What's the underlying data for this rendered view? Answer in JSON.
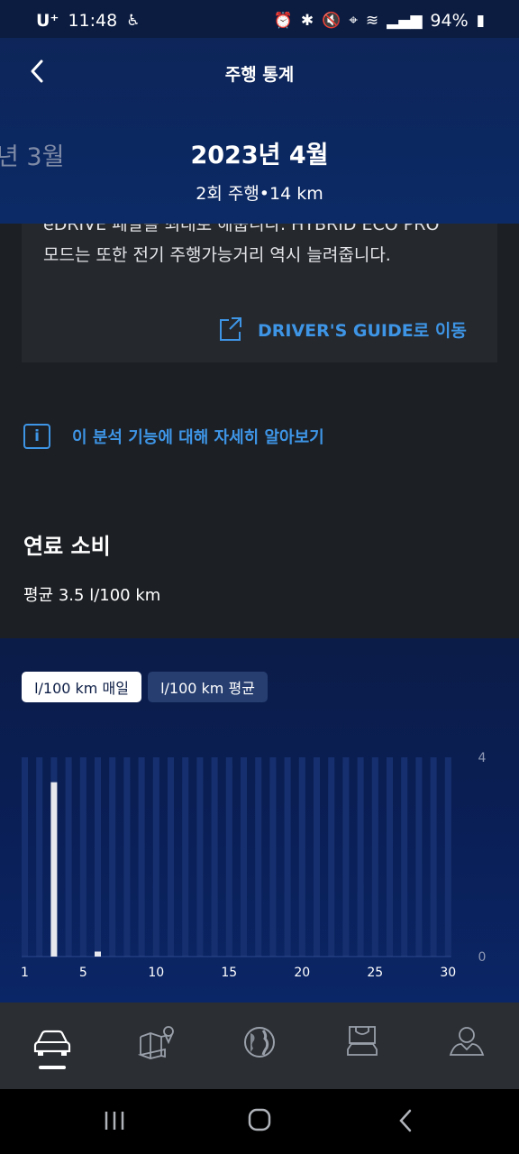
{
  "status_bar": {
    "carrier": "U⁺",
    "time": "11:48",
    "battery": "94%",
    "icons": [
      "accessibility-icon",
      "alarm-icon",
      "bluetooth-icon",
      "mute-icon",
      "location-icon",
      "wifi-icon",
      "signal-icon",
      "battery-icon"
    ]
  },
  "header": {
    "title": "주행 통계",
    "prev_month": "년 3월",
    "current_month": "2023년 4월",
    "summary": "2회 주행•14 km"
  },
  "card": {
    "cut_line": "eDRIVE 페달을 최대로 해줍니다. HYBRID ECO PRO",
    "text": "모드는 또한 전기 주행가능거리 역시 늘려줍니다.",
    "link_label": "DRIVER'S GUIDE로 이동"
  },
  "learn_more": "이 분석 기능에 대해 자세히 알아보기",
  "fuel": {
    "title": "연료 소비",
    "average": "평균 3.5 l/100 km"
  },
  "tabs": [
    {
      "label": "l/100 km 매일",
      "active": true
    },
    {
      "label": "l/100 km 평균",
      "active": false
    }
  ],
  "chart_data": {
    "type": "bar",
    "x": [
      1,
      2,
      3,
      4,
      5,
      6,
      7,
      8,
      9,
      10,
      11,
      12,
      13,
      14,
      15,
      16,
      17,
      18,
      19,
      20,
      21,
      22,
      23,
      24,
      25,
      26,
      27,
      28,
      29,
      30
    ],
    "values": [
      0,
      0,
      3.5,
      0,
      0,
      0.1,
      0,
      0,
      0,
      0,
      0,
      0,
      0,
      0,
      0,
      0,
      0,
      0,
      0,
      0,
      0,
      0,
      0,
      0,
      0,
      0,
      0,
      0,
      0,
      0
    ],
    "ylim": [
      0,
      4
    ],
    "y_ticks": [
      "4",
      "0"
    ],
    "x_ticks": [
      "1",
      "5",
      "10",
      "15",
      "20",
      "25",
      "30"
    ],
    "x_tick_values": [
      1,
      5,
      10,
      15,
      20,
      25,
      30
    ],
    "colors": {
      "bar": "#e6e8ee",
      "track": "#16306f"
    }
  },
  "bottom_nav": [
    "car-icon",
    "map-icon",
    "globe-icon",
    "shop-icon",
    "profile-icon"
  ]
}
